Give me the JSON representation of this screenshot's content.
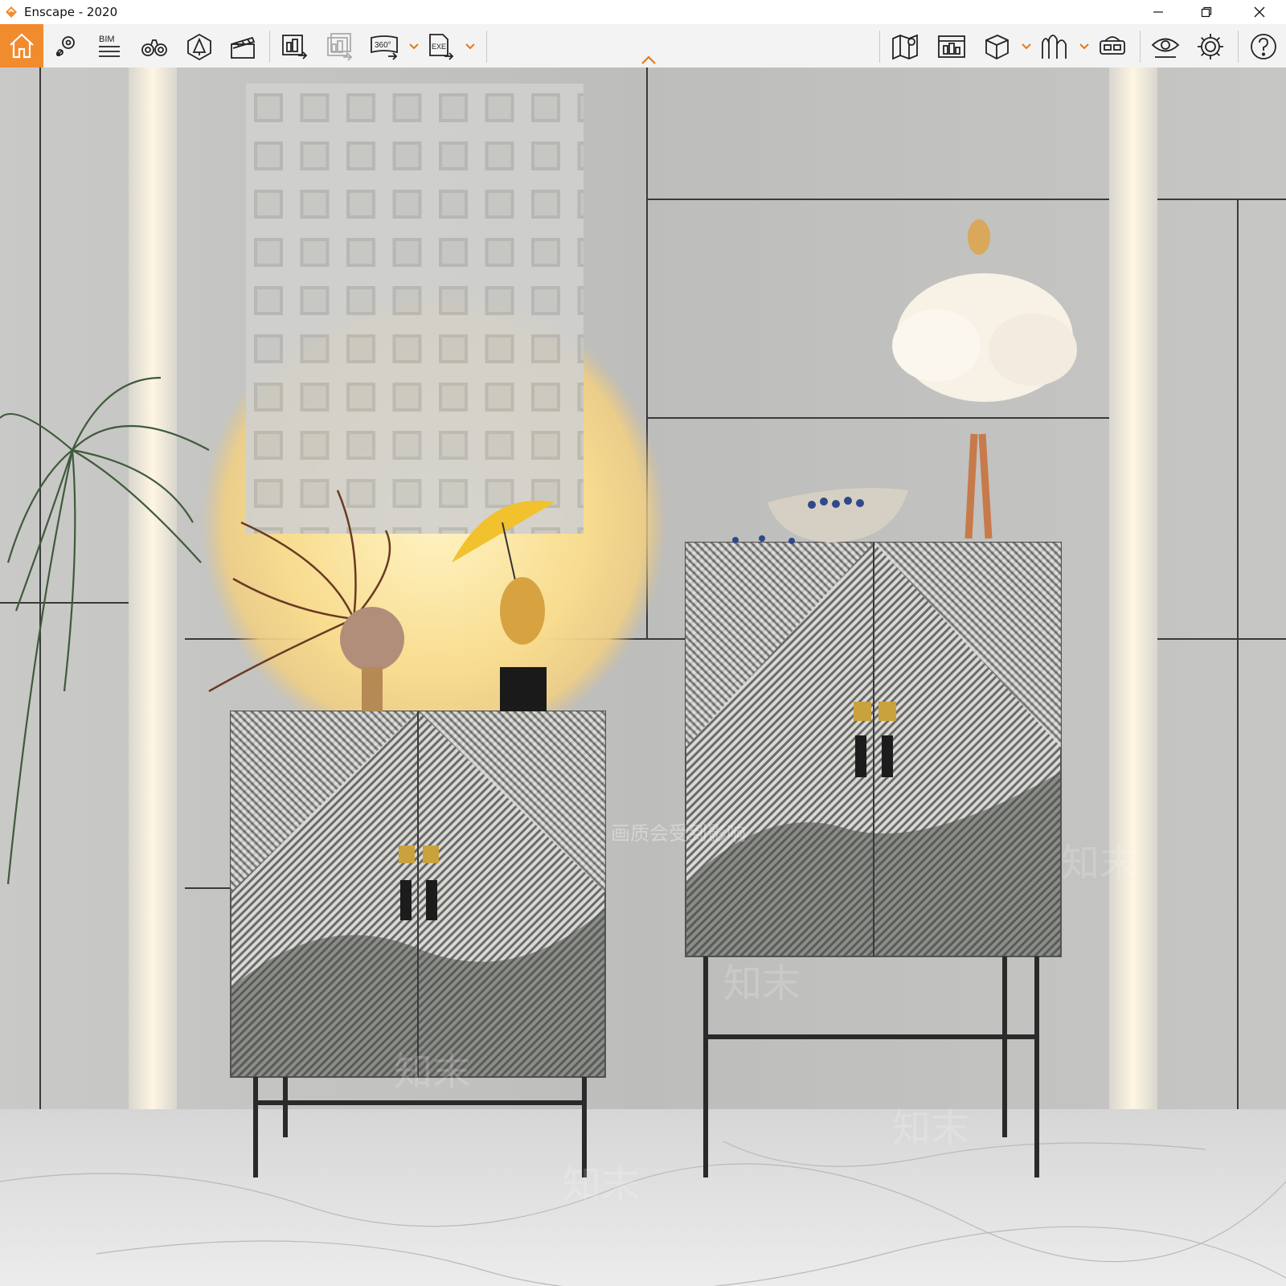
{
  "window": {
    "title": "Enscape - 2020",
    "accent_color": "#f08b2e"
  },
  "toolbar": {
    "bim_label": "BIM",
    "pano_label": "360°",
    "exe_label": "EXE",
    "left_icons": [
      "home-icon",
      "view-management-icon",
      "bim-icon",
      "binoculars-icon",
      "asset-library-icon",
      "video-editor-icon",
      "screenshot-export-icon",
      "batch-render-icon",
      "panorama-360-icon",
      "exe-export-icon"
    ],
    "right_icons": [
      "map-pin-icon",
      "collaborative-annotation-icon",
      "cube-icon",
      "site-context-icon",
      "vr-headset-icon",
      "visual-settings-eye-icon",
      "settings-gear-icon",
      "help-question-icon"
    ]
  },
  "watermark": {
    "text": "画质会受到影响",
    "brand_text": "知末"
  }
}
